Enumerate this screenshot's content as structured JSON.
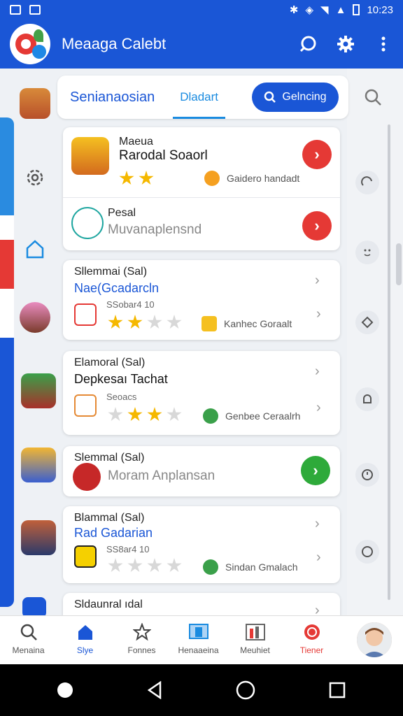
{
  "status_bar": {
    "time": "10:23"
  },
  "app_bar": {
    "title": "Meaaga Calebt"
  },
  "tabs": {
    "tab1": "Senianaosian",
    "tab2": "Dladart",
    "button": "Gelncing"
  },
  "cards": [
    {
      "title": "Maeua",
      "subtitle": "Rarodal Soaorl",
      "rating": 2,
      "badge": "Gaidero handadt",
      "action": "go",
      "action_color": "#e53935"
    },
    {
      "title": "Pesal",
      "subtitle": "Muvanaplensnd",
      "action": "go",
      "action_color": "#e53935"
    },
    {
      "title": "Sllemmai (Sal)",
      "subtitle": "Nae(Gcadarcln",
      "meta": "SSobar4 10",
      "rating": 2,
      "badge": "Kanhec Goraalt",
      "action": "chevron"
    },
    {
      "title": "Elamoral (Sal)",
      "subtitle": "Depkesaı Tachat",
      "meta": "Seoacs",
      "rating": 2,
      "badge": "Genbee Ceraalrh",
      "action": "chevron"
    },
    {
      "title": "Slemmal (Sal)",
      "subtitle": "Moram Anplansan",
      "action": "go",
      "action_color": "#2eaa3a"
    },
    {
      "title": "Blammal (Sal)",
      "subtitle": "Rad Gadarian",
      "meta": "SS8ar4 10",
      "rating": 0,
      "badge": "Sindan Gmalach",
      "action": "chevron"
    },
    {
      "title": "Sldaunral ıdal",
      "action": "chevron"
    }
  ],
  "bottom_nav": [
    {
      "label": "Menaina",
      "icon": "search-icon"
    },
    {
      "label": "Slye",
      "icon": "home-icon",
      "active": true
    },
    {
      "label": "Fonnes",
      "icon": "star-outline-icon"
    },
    {
      "label": "Henaaeina",
      "icon": "tablet-icon"
    },
    {
      "label": "Meuhiet",
      "icon": "chart-icon"
    },
    {
      "label": "Tiener",
      "icon": "record-icon",
      "accent": "#e53935"
    }
  ],
  "colors": {
    "primary": "#1a56d6",
    "accent_red": "#e53935",
    "accent_green": "#2eaa3a",
    "star": "#f5b800"
  }
}
